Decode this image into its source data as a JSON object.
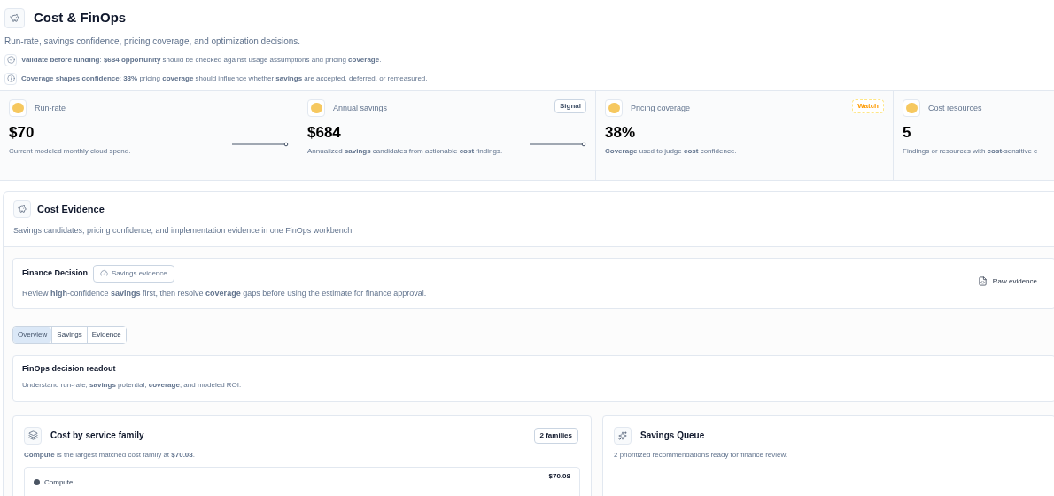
{
  "header": {
    "title": "Cost & FinOps",
    "subtitle": "Run-rate, savings confidence, pricing coverage, and optimization decisions.",
    "notes": [
      {
        "kind": "check",
        "text": "**Validate before funding**: **$684 opportunity** should be checked against usage assumptions and pricing **coverage**."
      },
      {
        "kind": "info",
        "text": "**Coverage shapes confidence**: **38%** pricing **coverage** should influence whether **savings** are accepted, deferred, or remeasured."
      }
    ]
  },
  "kpis": [
    {
      "label": "Run-rate",
      "value": "$70",
      "description": "Current modeled monthly cloud spend.",
      "trend": true
    },
    {
      "label": "Annual savings",
      "value": "$684",
      "description": "Annualized **savings** candidates from actionable **cost** findings.",
      "trend": true,
      "badge": {
        "text": "Signal",
        "kind": "neutral"
      }
    },
    {
      "label": "Pricing coverage",
      "value": "38%",
      "description": "**Coverage** used to judge **cost** confidence.",
      "trend": false,
      "badge": {
        "text": "Watch",
        "kind": "warning"
      }
    },
    {
      "label": "Cost resources",
      "value": "5",
      "description": "Findings or resources with **cost**-sensitive c",
      "trend": false
    }
  ],
  "evidence": {
    "title": "Cost Evidence",
    "subtitle": "Savings candidates, pricing confidence, and implementation evidence in one FinOps workbench.",
    "decision": {
      "title": "Finance Decision",
      "chip": "Savings evidence",
      "text": "Review **high**-confidence **savings** first, then resolve **coverage** gaps before using the estimate for finance approval.",
      "action": "Raw evidence"
    },
    "tabs": [
      {
        "label": "Overview",
        "selected": true
      },
      {
        "label": "Savings",
        "selected": false
      },
      {
        "label": "Evidence",
        "selected": false
      }
    ],
    "readout": {
      "title": "FinOps decision readout",
      "text": "Understand run-rate, **savings** potential, **coverage**, and modeled ROI."
    },
    "service_family": {
      "title": "Cost by service family",
      "badge": "2 families",
      "subtitle": "**Compute** is the largest matched cost family at **$70.08**.",
      "rows": [
        {
          "name": "Compute",
          "amount": "$70.08",
          "color": "#4b5563"
        }
      ]
    },
    "savings_queue": {
      "title": "Savings Queue",
      "subtitle": "2 prioritized recommendations ready for finance review."
    }
  }
}
